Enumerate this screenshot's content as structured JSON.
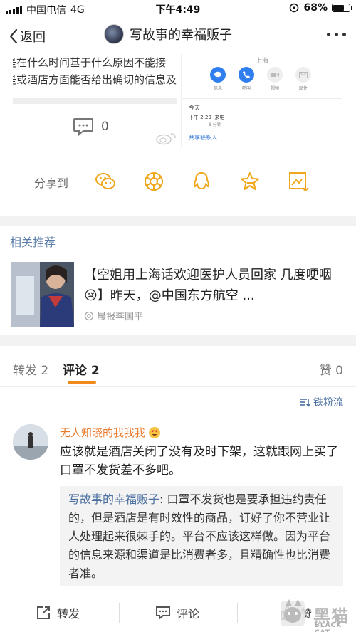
{
  "status_bar": {
    "carrier": "中国电信",
    "network": "4G",
    "time": "下午4:49",
    "battery": "68%",
    "battery_level": 0.68
  },
  "nav": {
    "back_label": "返回",
    "title": "写故事的幸福贩子"
  },
  "post": {
    "image_left_lines": [
      "是在什么时间基于什么原因不能接",
      "是或酒店方面能否给出确切的信息及"
    ],
    "image_right": {
      "city": "上海",
      "actions": [
        "信息",
        "呼叫",
        "视频",
        "邮件"
      ],
      "today": "今天",
      "call_time": "下午 2:29",
      "call_type": "来电",
      "call_duration": "8 分钟",
      "share_contact": "共享联系人"
    },
    "comment_count": "0"
  },
  "share": {
    "label": "分享到",
    "targets": [
      "wechat-icon",
      "moments-icon",
      "qq-icon",
      "favorite-icon",
      "save-image-icon"
    ]
  },
  "related": {
    "header": "相关推荐",
    "title": "【空姐用上海话欢迎医护人员回家 几度哽咽😢】昨天，@中国东方航空 ...",
    "author": "晨报李国平"
  },
  "tabs": {
    "repost": "转发 2",
    "comment": "评论 2",
    "like": "赞 0"
  },
  "sort_label": "铁粉流",
  "comment": {
    "user": "无人知晓的我我我",
    "text": "应该就是酒店关闭了没有及时下架，这就跟网上买了口罩不发货差不多吧。",
    "reply_author": "写故事的幸福贩子",
    "reply_text": ": 口罩不发货也是要承担违约责任的，但是酒店是有时效性的商品，订好了你不营业让人处理起来很棘手的。平台不应该这样做。因为平台的信息来源和渠道是比消费者多，且精确性也比消费者准。"
  },
  "bottom_bar": {
    "repost": "转发",
    "comment": "评论",
    "like": "赞"
  },
  "watermark": {
    "text": "黑猫",
    "sub": "BLACK CAT"
  },
  "colors": {
    "accent_orange": "#e8792a",
    "link_blue": "#4a6fa0",
    "tab_underline": "#f28a1b"
  }
}
